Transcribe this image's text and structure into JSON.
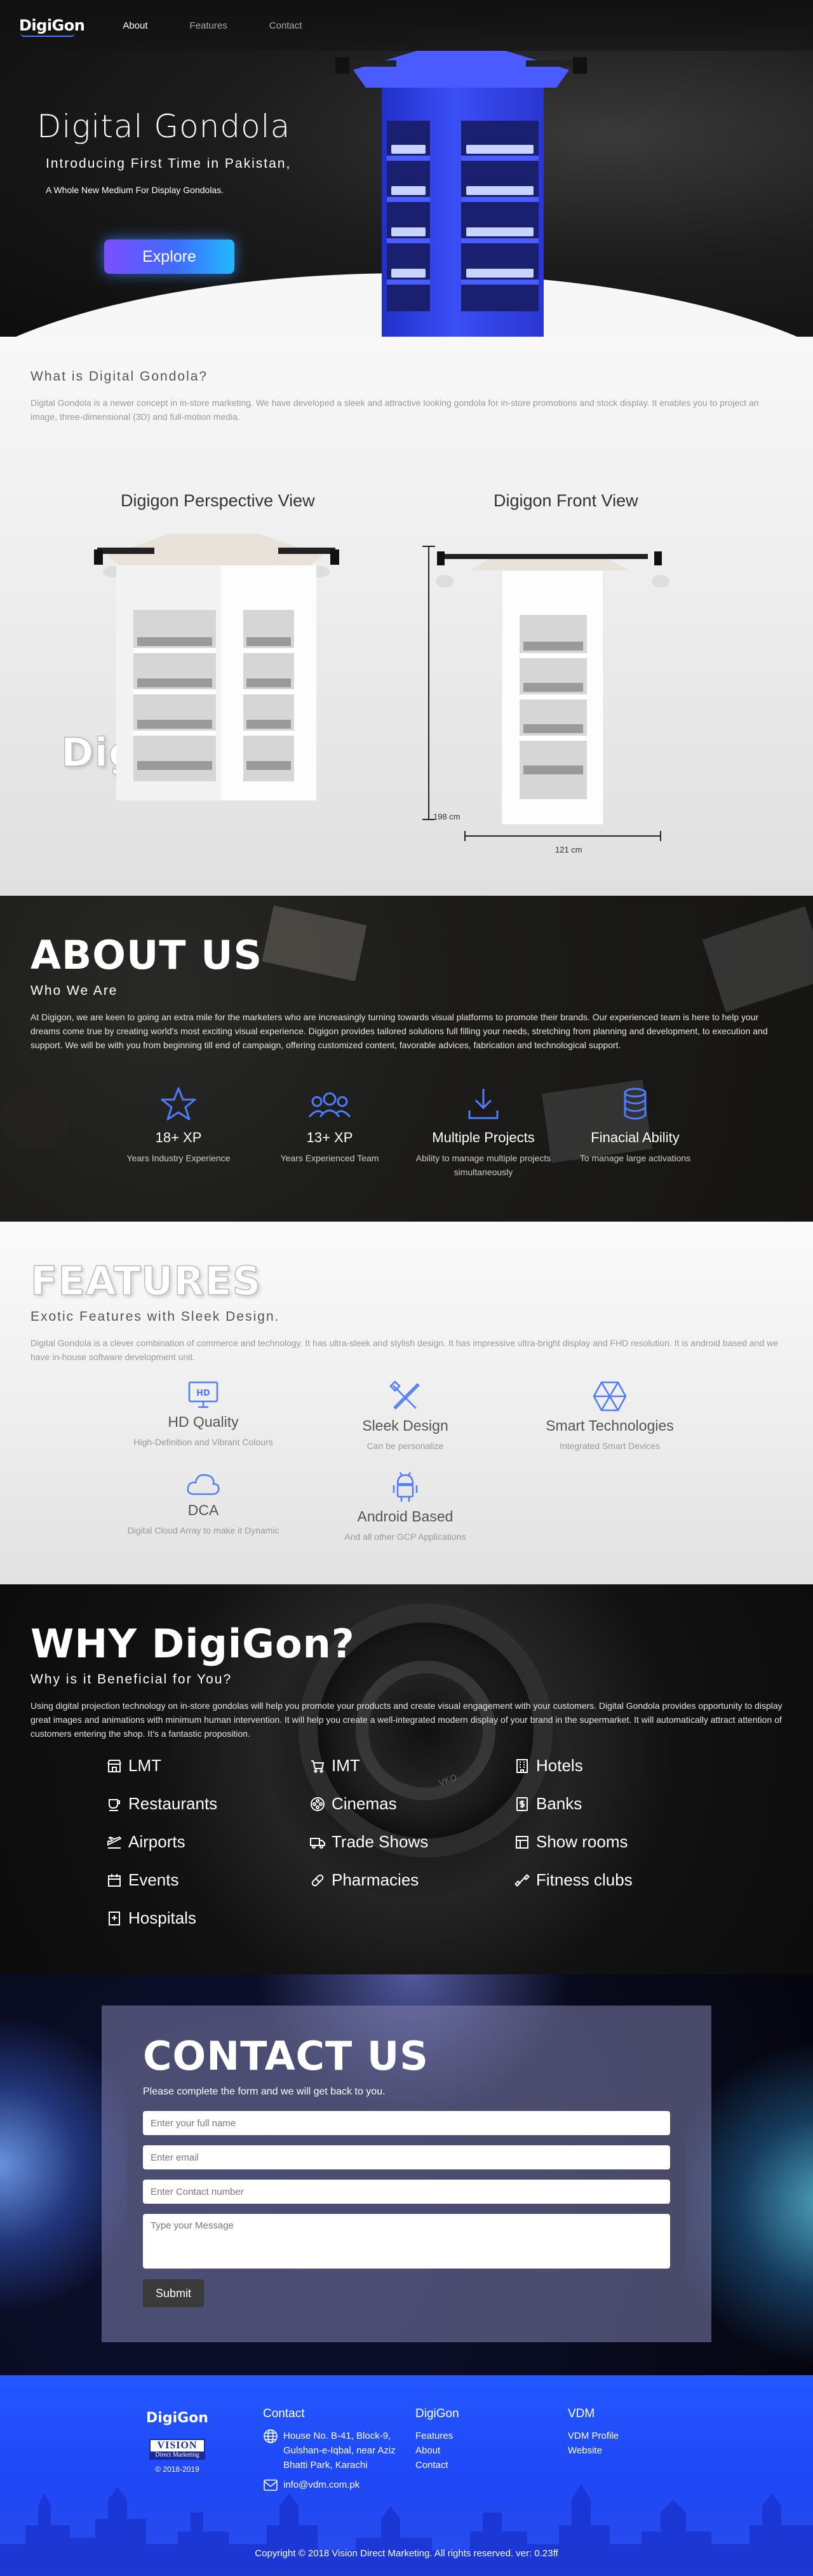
{
  "nav": {
    "logo": "DigiGon",
    "links": [
      "About",
      "Features",
      "Contact"
    ]
  },
  "hero": {
    "title": "Digital Gondola",
    "subtitle": "Introducing First Time in Pakistan,",
    "tagline": "A Whole New Medium For Display Gondolas.",
    "button": "Explore"
  },
  "digigon": {
    "title": "DigiGon™",
    "subtitle": "What is Digital Gondola?",
    "text": "Digital Gondola is a newer concept in in-store marketing. We have developed a sleek and attractive looking gondola for in-store promotions and stock display. It enables you to project an image, three-dimensional (3D) and full-motion media.",
    "perspective_label": "Digigon Perspective View",
    "front_label": "Digigon Front View",
    "height_dim": "198 cm",
    "width_dim": "121 cm"
  },
  "about": {
    "title": "ABOUT US",
    "subtitle": "Who We Are",
    "text": "At Digigon, we are keen to going an extra mile for the marketers who are increasingly turning towards visual platforms to promote their brands. Our experienced team is here to help your dreams come true by creating world's most exciting visual experience. Digigon provides tailored solutions full filling your needs, stretching from planning and development, to execution and support. We will be with you from beginning till end of campaign, offering customized content, favorable advices, fabrication and technological support.",
    "stats": [
      {
        "icon": "star-icon",
        "value": "18+ XP",
        "label": "Years Industry Experience"
      },
      {
        "icon": "team-icon",
        "value": "13+ XP",
        "label": "Years Experienced Team"
      },
      {
        "icon": "download-icon",
        "value": "Multiple Projects",
        "label": "Ability to manage multiple projects simultaneously"
      },
      {
        "icon": "database-icon",
        "value": "Finacial Ability",
        "label": "To manage large activations"
      }
    ]
  },
  "features": {
    "title": "FEATURES",
    "subtitle": "Exotic Features with Sleek Design.",
    "text": "Digital Gondola is a clever combination of commerce and technology. It has ultra-sleek and stylish design. It has impressive ultra-bright display and FHD resolution. It is android based and we have in-house software development unit.",
    "items": [
      {
        "icon": "hd-icon",
        "name": "HD Quality",
        "desc": "High-Definition and Vibrant Colours"
      },
      {
        "icon": "design-tools-icon",
        "name": "Sleek Design",
        "desc": "Can be personalize"
      },
      {
        "icon": "hexagon-icon",
        "name": "Smart Technologies",
        "desc": "Integrated Smart Devices"
      },
      {
        "icon": "cloud-icon",
        "name": "DCA",
        "desc": "Digital Cloud Array to make it Dynamic"
      },
      {
        "icon": "android-icon",
        "name": "Android Based",
        "desc": "And all other GCP Applications"
      }
    ]
  },
  "why": {
    "title": "WHY DigiGon?",
    "subtitle": "Why is it Beneficial for You?",
    "text": "Using digital projection technology on in-store gondolas will help you promote your products and create visual engagement with your customers. Digital Gondola provides opportunity to display great images and animations with minimum human intervention. It will help you create a well-integrated modern display of your brand in the supermarket. It will automatically attract attention of customers entering the shop. It's a fantastic proposition.",
    "lens_text": "VKO",
    "places": [
      {
        "icon": "shop-icon",
        "name": "LMT"
      },
      {
        "icon": "cart-icon",
        "name": "IMT"
      },
      {
        "icon": "building-icon",
        "name": "Hotels"
      },
      {
        "icon": "cup-icon",
        "name": "Restaurants"
      },
      {
        "icon": "film-reel-icon",
        "name": "Cinemas"
      },
      {
        "icon": "bank-icon",
        "name": "Banks"
      },
      {
        "icon": "plane-icon",
        "name": "Airports"
      },
      {
        "icon": "truck-icon",
        "name": "Trade Shows"
      },
      {
        "icon": "room-icon",
        "name": "Show rooms"
      },
      {
        "icon": "calendar-icon",
        "name": "Events"
      },
      {
        "icon": "pill-icon",
        "name": "Pharmacies"
      },
      {
        "icon": "dumbbell-icon",
        "name": "Fitness clubs"
      },
      {
        "icon": "hospital-icon",
        "name": "Hospitals"
      }
    ]
  },
  "contact": {
    "title": "CONTACT US",
    "subtitle": "Please complete the form and we will get back to you.",
    "name_placeholder": "Enter your full name",
    "email_placeholder": "Enter email",
    "phone_placeholder": "Enter Contact number",
    "message_placeholder": "Type your Message",
    "submit": "Submit"
  },
  "footer": {
    "logo": "DigiGon",
    "vision_logo": "VISION",
    "vision_sub": "Direct Marketing",
    "years": "© 2018-2019",
    "contact_head": "Contact",
    "address": [
      "House No. B-41, Block-9,",
      "Gulshan-e-Iqbal, near Aziz",
      "Bhatti Park, Karachi"
    ],
    "email": "info@vdm.com.pk",
    "digigon_head": "DigiGon",
    "digigon_links": [
      "Features",
      "About",
      "Contact"
    ],
    "vdm_head": "VDM",
    "vdm_links": [
      "VDM Profile",
      "Website"
    ],
    "copyright": "Copyright © 2018 Vision Direct Marketing. All rights reserved. ver: 0.23ff"
  },
  "colors": {
    "accent_blue": "#3f6cff",
    "icon_blue": "#4f7bff",
    "footer_blue": "#2357ff",
    "gondola_blue": "#2b3fe0"
  }
}
